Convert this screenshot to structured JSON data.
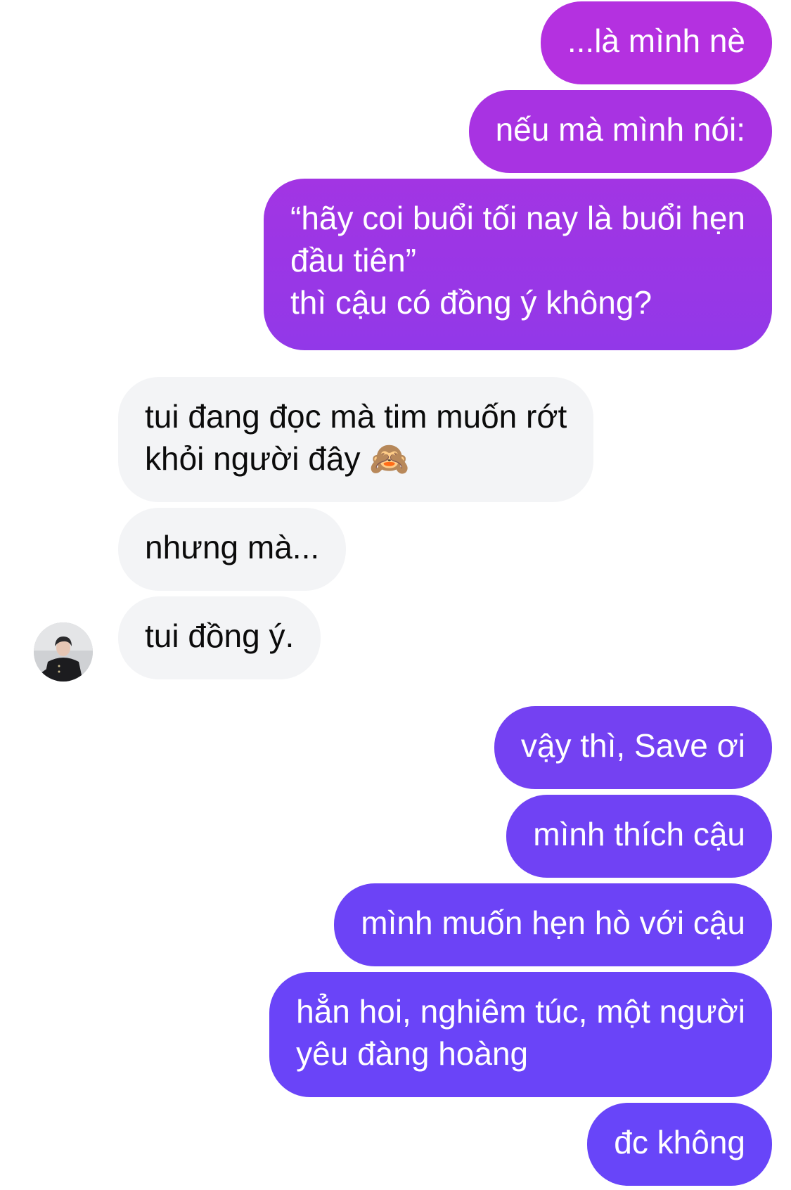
{
  "colors": {
    "outgoing_top": "#b431e0",
    "outgoing_bottom": "#6a44f8",
    "incoming_bg": "#f3f4f6",
    "incoming_text": "#0b0b0b"
  },
  "messages": [
    {
      "side": "outgoing",
      "text": "...là mình nè"
    },
    {
      "side": "outgoing",
      "text": "nếu mà mình nói:"
    },
    {
      "side": "outgoing",
      "text": "“hãy coi buổi tối nay là buổi hẹn\nđầu tiên”\nthì cậu có đồng ý không?"
    },
    {
      "side": "incoming",
      "text": "tui đang đọc mà tim muốn rớt\nkhỏi người đây 🙈"
    },
    {
      "side": "incoming",
      "text": "nhưng mà..."
    },
    {
      "side": "incoming",
      "text": "tui đồng ý."
    },
    {
      "side": "outgoing",
      "text": "vậy thì, Save ơi"
    },
    {
      "side": "outgoing",
      "text": "mình thích cậu"
    },
    {
      "side": "outgoing",
      "text": "mình muốn hẹn hò với cậu"
    },
    {
      "side": "outgoing",
      "text": "hẳn hoi, nghiêm túc, một người\nyêu đàng hoàng"
    },
    {
      "side": "outgoing",
      "text": "đc không"
    }
  ],
  "avatar": {
    "icon": "contact-avatar"
  }
}
